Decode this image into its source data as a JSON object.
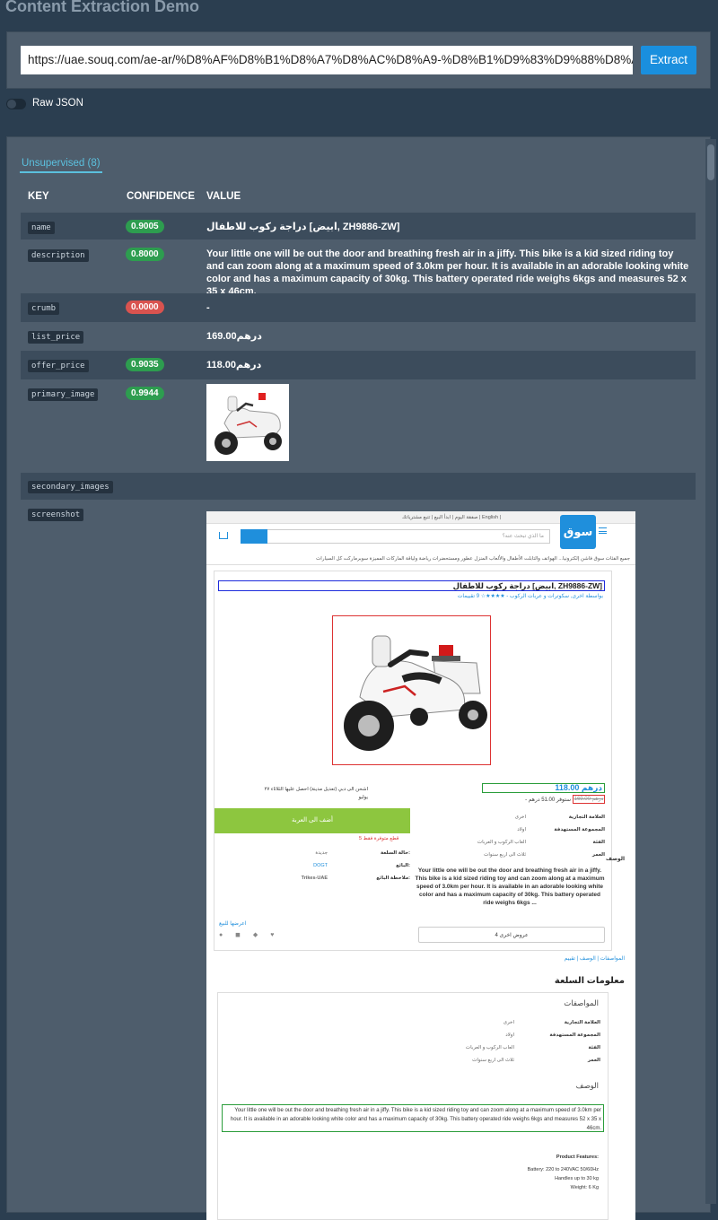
{
  "page": {
    "title": "Content Extraction Demo"
  },
  "extract_form": {
    "url_value": "https://uae.souq.com/ae-ar/%D8%AF%D8%B1%D8%A7%D8%AC%D8%A9-%D8%B1%D9%83%D9%88%D8%A8-%",
    "button_label": "Extract"
  },
  "raw_json_toggle": {
    "label": "Raw JSON",
    "on": false
  },
  "results": {
    "tab_label": "Unsupervised (8)",
    "columns": {
      "key": "KEY",
      "confidence": "CONFIDENCE",
      "value": "VALUE"
    },
    "rows": [
      {
        "key": "name",
        "confidence": "0.9005",
        "confidence_color": "#2d9d4f",
        "value": "دراجة ركوب للاطفال [ابيض, ZH9886-ZW]"
      },
      {
        "key": "description",
        "confidence": "0.8000",
        "confidence_color": "#2d9d4f",
        "value": "Your little one will be out the door and breathing fresh air in a jiffy. This bike is a kid sized riding toy and can zoom along at a maximum speed of 3.0km per hour. It is available in an adorable looking white color and has a maximum capacity of 30kg. This battery operated ride weighs 6kgs and measures 52 x 35 x 46cm."
      },
      {
        "key": "crumb",
        "confidence": "0.0000",
        "confidence_color": "#d9534f",
        "value": "-"
      },
      {
        "key": "list_price",
        "confidence": "",
        "value": "169.00درهم"
      },
      {
        "key": "offer_price",
        "confidence": "0.9035",
        "confidence_color": "#2d9d4f",
        "value": "118.00درهم"
      },
      {
        "key": "primary_image",
        "confidence": "0.9944",
        "confidence_color": "#2d9d4f",
        "value": ""
      },
      {
        "key": "secondary_images",
        "confidence": "",
        "value": ""
      },
      {
        "key": "screenshot",
        "confidence": "",
        "value": ""
      }
    ]
  },
  "screenshot": {
    "topbar": "صفقة اليوم | ابدأ البيع | تتبع مشترياتك | English |",
    "logo": "سوق",
    "search_placeholder": "ما الذي تبحث عنه؟",
    "navbar": "جميع الفئات    سوق فاشن    إلكترونيا...   الهواتف والتابلت   الأطفال والألعاب   المنزل   عطور ومستحضرات   رياضة ولياقة   الماركات المميزة   سوبرماركت   كل السيارات",
    "product_title": "دراجة ركوب للاطفال [ابيض, ZH9886-ZW]",
    "byline": "بواسطة اخرى, سكوترات و عربات الركوب - ★★★★☆ 9 تقييمات",
    "price": "118.00 درهم",
    "old_price": "169.00 درهم",
    "save_text": "- ستوفر 51.00 درهم",
    "shipping": "اشحن الى دبي (تعديل مدينة)\nاحصل عليها الثلاثاء ٢٧ يوليو",
    "add_button": "أضف الى العربة",
    "stock_note": "5 قطع متوفرة فقط",
    "specs": [
      {
        "k": "العلامة التجارية",
        "v": "اخرى"
      },
      {
        "k": "المجموعة المستهدفة",
        "v": "اولاد"
      },
      {
        "k": "الفئة",
        "v": "العاب الركوب و العربات"
      },
      {
        "k": "العمر",
        "v": "ثلاث الى اربع سنوات"
      }
    ],
    "seller_rows": [
      {
        "k": "حالة السلعة:",
        "v": "جديدة"
      },
      {
        "k": "البائع:",
        "v": "DOGT"
      },
      {
        "k": "ملاحظة البائع:",
        "v": "Trikes-UAE"
      }
    ],
    "desc_label": "الوصف",
    "desc_short": "Your little one will be out the door and breathing fresh air in a jiffy. This bike is a kid sized riding toy and can zoom along at a maximum speed of 3.0km per hour. It is available in an adorable looking white color and has a maximum capacity of 30kg. This battery operated ride weighs 6kgs ...",
    "other_offers": "4 عروض اخرى",
    "share_label": "اعرضها للبيع",
    "tabs": "المواصفات  |  الوصف  |  تقييم",
    "info_heading": "معلومات السلعة",
    "spec_heading": "المواصفات",
    "desc_heading": "الوصف",
    "desc_long": "Your little one will be out the door and breathing fresh air in a jiffy. This bike is a kid sized riding toy and can zoom along at a maximum speed of 3.0km per hour. It is available in an adorable looking white color and has a maximum capacity of 30kg. This battery operated ride weighs 6kgs and measures 52 x 35 x 46cm.",
    "features_heading": "Product Features:",
    "features": [
      "Battery: 220 to 240VAC 50/60Hz",
      "Handles up to 30 kg",
      "Weight: 6 Kg"
    ]
  }
}
